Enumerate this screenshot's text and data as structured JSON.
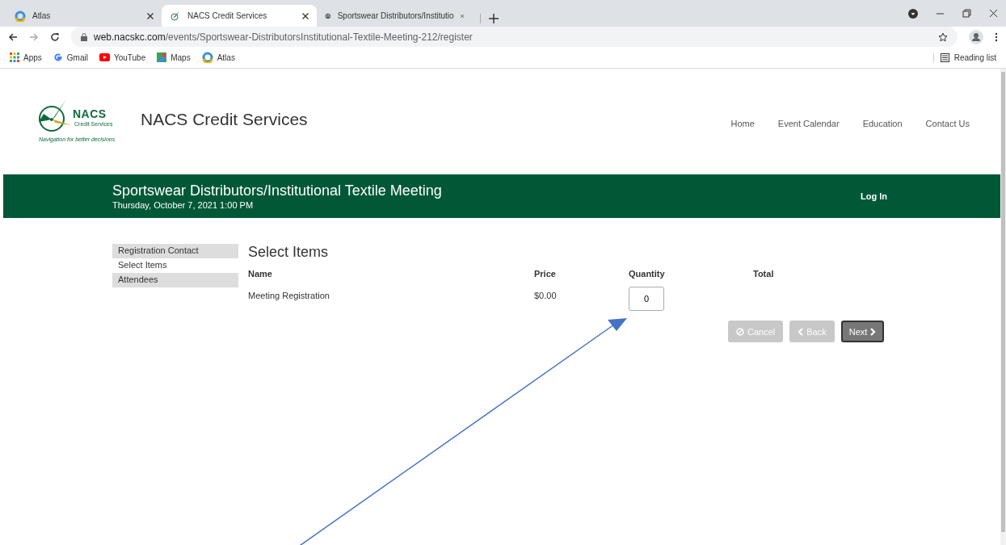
{
  "browser": {
    "tabs": [
      {
        "title": "Atlas",
        "selected": false
      },
      {
        "title": "NACS Credit Services",
        "selected": true
      },
      {
        "title": "Sportswear Distributors/Institutio",
        "selected": false
      }
    ],
    "url_host": "web.nacskc.com",
    "url_path": "/events/Sportswear-DistributorsInstitutional-Textile-Meeting-212/register",
    "bookmarks": [
      "Apps",
      "Gmail",
      "YouTube",
      "Maps",
      "Atlas"
    ],
    "reading_list": "Reading list"
  },
  "site": {
    "logo_word": "NACS",
    "logo_sub": "Credit Services",
    "logo_tagline": "Navigation for better decisions",
    "name": "NACS Credit Services",
    "nav": [
      "Home",
      "Event Calendar",
      "Education",
      "Contact Us"
    ]
  },
  "event": {
    "title": "Sportswear Distributors/Institutional Textile Meeting",
    "date": "Thursday, October 7, 2021 1:00 PM",
    "login": "Log In"
  },
  "steps": [
    {
      "label": "Registration Contact",
      "selected": false
    },
    {
      "label": "Select Items",
      "selected": true
    },
    {
      "label": "Attendees",
      "selected": false
    }
  ],
  "section_title": "Select Items",
  "table": {
    "columns": [
      "Name",
      "Price",
      "Quantity",
      "Total"
    ],
    "rows": [
      {
        "name": "Meeting Registration",
        "price": "$0.00",
        "quantity": "0"
      }
    ]
  },
  "buttons": [
    {
      "label": "Cancel",
      "disabled": true
    },
    {
      "label": "Back",
      "disabled": true
    },
    {
      "label": "Next",
      "disabled": false
    }
  ]
}
